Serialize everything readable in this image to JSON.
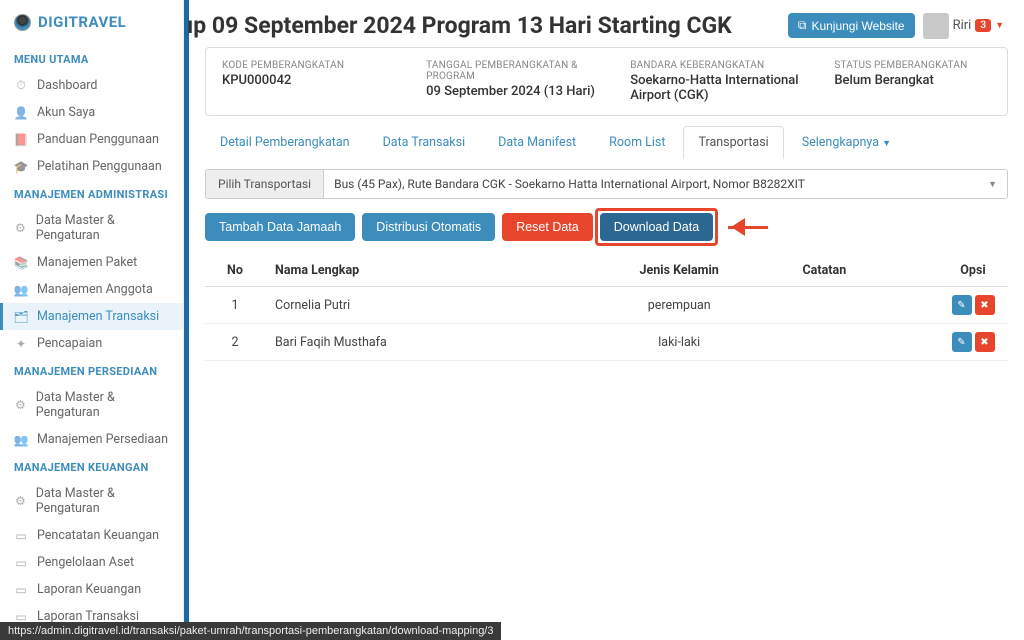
{
  "brand": "DIGITRAVEL",
  "user": {
    "name": "Riri",
    "badge": "3"
  },
  "visit_website_label": "Kunjungi Website",
  "page_title": "ıp 09 September 2024 Program 13 Hari Starting CGK",
  "sections": [
    {
      "title": "MENU UTAMA",
      "items": [
        {
          "icon": "⏱",
          "label": "Dashboard",
          "name": "nav-dashboard"
        },
        {
          "icon": "👤",
          "label": "Akun Saya",
          "name": "nav-akun"
        },
        {
          "icon": "📕",
          "label": "Panduan Penggunaan",
          "name": "nav-panduan"
        },
        {
          "icon": "🎓",
          "label": "Pelatihan Penggunaan",
          "name": "nav-pelatihan"
        }
      ]
    },
    {
      "title": "MANAJEMEN ADMINISTRASI",
      "items": [
        {
          "icon": "⚙",
          "label": "Data Master & Pengaturan",
          "name": "nav-master-admin"
        },
        {
          "icon": "📚",
          "label": "Manajemen Paket",
          "name": "nav-paket"
        },
        {
          "icon": "👥",
          "label": "Manajemen Anggota",
          "name": "nav-anggota"
        },
        {
          "icon": "🗂",
          "label": "Manajemen Transaksi",
          "name": "nav-transaksi",
          "active": true
        },
        {
          "icon": "✦",
          "label": "Pencapaian",
          "name": "nav-pencapaian"
        }
      ]
    },
    {
      "title": "MANAJEMEN PERSEDIAAN",
      "items": [
        {
          "icon": "⚙",
          "label": "Data Master & Pengaturan",
          "name": "nav-master-stok"
        },
        {
          "icon": "👥",
          "label": "Manajemen Persediaan",
          "name": "nav-persediaan"
        }
      ]
    },
    {
      "title": "MANAJEMEN KEUANGAN",
      "items": [
        {
          "icon": "⚙",
          "label": "Data Master & Pengaturan",
          "name": "nav-master-keu"
        },
        {
          "icon": "▭",
          "label": "Pencatatan Keuangan",
          "name": "nav-pencatatan"
        },
        {
          "icon": "▭",
          "label": "Pengelolaan Aset",
          "name": "nav-aset"
        },
        {
          "icon": "▭",
          "label": "Laporan Keuangan",
          "name": "nav-lap-keu"
        },
        {
          "icon": "▭",
          "label": "Laporan Transaksi",
          "name": "nav-lap-trans"
        }
      ]
    }
  ],
  "info": {
    "kode_label": "KODE PEMBERANGKATAN",
    "kode_value": "KPU000042",
    "tanggal_label": "TANGGAL PEMBERANGKATAN & PROGRAM",
    "tanggal_value": "09 September 2024 (13 Hari)",
    "bandara_label": "BANDARA KEBERANGKATAN",
    "bandara_value": "Soekarno-Hatta International Airport (CGK)",
    "status_label": "STATUS PEMBERANGKATAN",
    "status_value": "Belum Berangkat"
  },
  "tabs": {
    "detail": "Detail Pemberangkatan",
    "transaksi": "Data Transaksi",
    "manifest": "Data Manifest",
    "room": "Room List",
    "transportasi": "Transportasi",
    "selengkapnya": "Selengkapnya"
  },
  "transport": {
    "label": "Pilih Transportasi",
    "value": "Bus (45 Pax), Rute Bandara CGK - Soekarno Hatta International Airport, Nomor B8282XIT"
  },
  "actions": {
    "tambah": "Tambah Data Jamaah",
    "distribusi": "Distribusi Otomatis",
    "reset": "Reset Data",
    "download": "Download Data"
  },
  "table": {
    "headers": {
      "no": "No",
      "nama": "Nama Lengkap",
      "kelamin": "Jenis Kelamin",
      "catatan": "Catatan",
      "opsi": "Opsi"
    },
    "rows": [
      {
        "no": "1",
        "nama": "Cornelia Putri",
        "kelamin": "perempuan",
        "catatan": ""
      },
      {
        "no": "2",
        "nama": "Bari Faqih Musthafa",
        "kelamin": "laki-laki",
        "catatan": ""
      }
    ]
  },
  "statusbar": "https://admin.digitravel.id/transaksi/paket-umrah/transportasi-pemberangkatan/download-mapping/3"
}
